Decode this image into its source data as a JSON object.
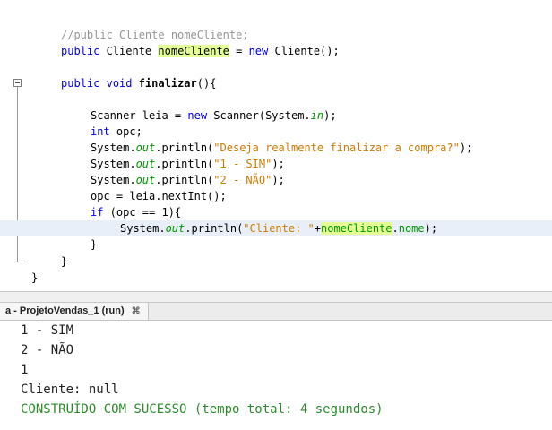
{
  "editor": {
    "lines": {
      "l1": {
        "comment": "//public Cliente nomeCliente;"
      },
      "l2": {
        "kw1": "public",
        "t1": " Cliente ",
        "field": "nomeCliente",
        "t2": " = ",
        "kw2": "new",
        "t3": " Cliente();"
      },
      "l4": {
        "kw1": "public",
        "kw2": "void",
        "method": "finalizar",
        "t1": "(){"
      },
      "l6": {
        "t1": "Scanner leia = ",
        "kw1": "new",
        "t2": " Scanner(System.",
        "it": "in",
        "t3": ");"
      },
      "l7": {
        "kw1": "int",
        "t1": " opc;"
      },
      "l8": {
        "t1": "System.",
        "it": "out",
        "t2": ".println(",
        "str": "\"Deseja realmente finalizar a compra?\"",
        "t3": ");"
      },
      "l9": {
        "t1": "System.",
        "it": "out",
        "t2": ".println(",
        "str": "\"1 - SIM\"",
        "t3": ");"
      },
      "l10": {
        "t1": "System.",
        "it": "out",
        "t2": ".println(",
        "str": "\"2 - NÃO\"",
        "t3": ");"
      },
      "l11": {
        "t1": "opc = leia.nextInt();"
      },
      "l12": {
        "kw1": "if",
        "t1": " (opc == 1){"
      },
      "l13": {
        "t1": "System.",
        "it": "out",
        "t2": ".println(",
        "str": "\"Cliente: \"",
        "t3": "+",
        "field": "nomeCliente",
        "t4": ".",
        "fld2": "nome",
        "t5": ");"
      },
      "l14": {
        "t1": "}"
      },
      "l15": {
        "t1": "}"
      },
      "l16": {
        "t1": "}"
      }
    }
  },
  "output_panel": {
    "tab_label": "a - ProjetoVendas_1 (run)",
    "tab_close": "⌘",
    "lines": [
      "1 - SIM",
      "2 - NÃO",
      "1",
      "Cliente: null"
    ],
    "success_line": "CONSTRUÍDO COM SUCESSO (tempo total: 4 segundos)"
  },
  "colors": {
    "keyword": "#0000e6",
    "comment": "#969696",
    "string": "#ce7b00",
    "static_field": "#009900",
    "highlight": "#e4ff96",
    "current_line": "#e9eff8",
    "success": "#2c8b2c"
  },
  "icons": {
    "fold": "collapse-minus-icon",
    "tab_close": "close-icon"
  }
}
